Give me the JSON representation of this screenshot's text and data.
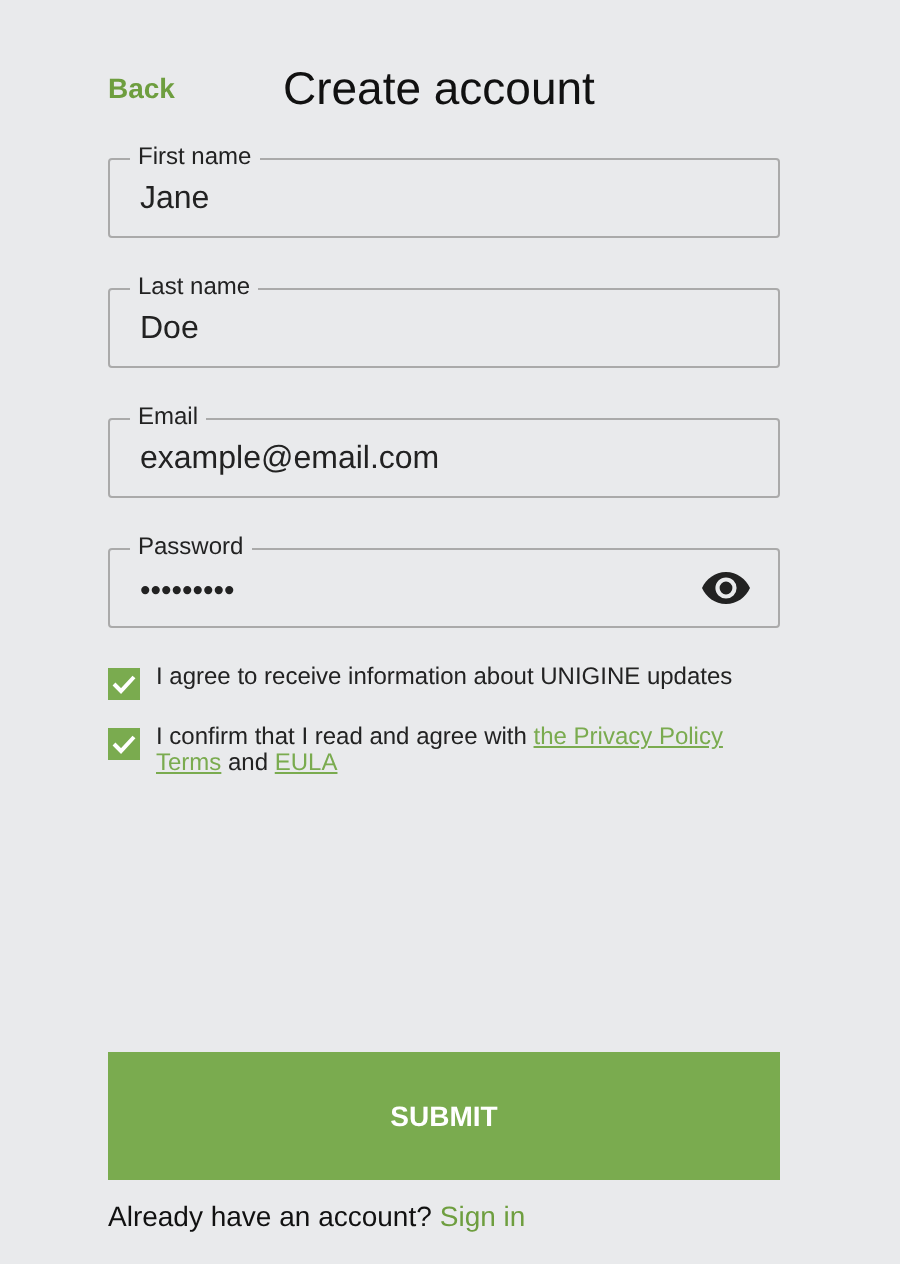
{
  "header": {
    "back": "Back",
    "title": "Create account"
  },
  "fields": [
    {
      "label": "First name",
      "value": "Jane",
      "kind": "text"
    },
    {
      "label": "Last name",
      "value": "Doe",
      "kind": "text"
    },
    {
      "label": "Email",
      "value": "example@email.com",
      "kind": "text"
    },
    {
      "label": "Password",
      "value": "•••••••••",
      "kind": "password"
    }
  ],
  "consents": [
    {
      "checked": true,
      "segments": [
        {
          "kind": "text",
          "text": "I agree to receive information about UNIGINE updates"
        }
      ]
    },
    {
      "checked": true,
      "segments": [
        {
          "kind": "text",
          "text": "I confirm that I read and agree with "
        },
        {
          "kind": "link",
          "text": "the Privacy Policy"
        },
        {
          "kind": "break"
        },
        {
          "kind": "link",
          "text": "Terms"
        },
        {
          "kind": "text",
          "text": " and "
        },
        {
          "kind": "link",
          "text": "EULA"
        }
      ]
    }
  ],
  "submit": "SUBMIT",
  "footer": {
    "text": "Already have an account?",
    "link": "Sign in"
  }
}
